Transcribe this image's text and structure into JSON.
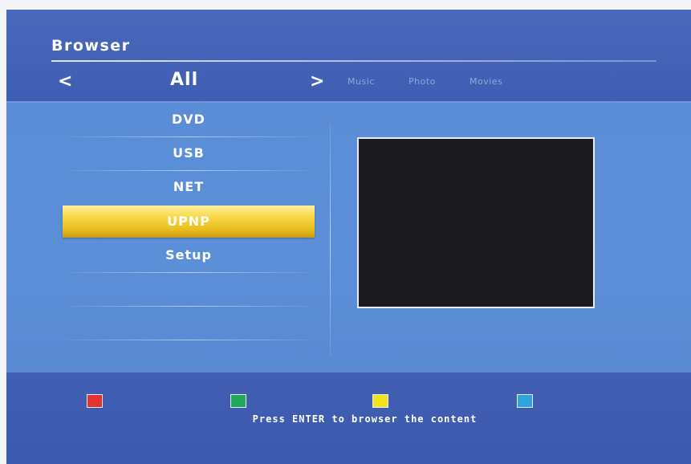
{
  "header": {
    "title": "Browser",
    "nav": {
      "prev_glyph": "<",
      "current_filter": "All",
      "next_glyph": ">",
      "options": [
        "Music",
        "Photo",
        "Movies"
      ]
    }
  },
  "menu": {
    "items": [
      {
        "label": "DVD",
        "selected": false
      },
      {
        "label": "USB",
        "selected": false
      },
      {
        "label": "NET",
        "selected": false
      },
      {
        "label": "UPNP",
        "selected": true
      },
      {
        "label": "Setup",
        "selected": false
      }
    ]
  },
  "footer": {
    "color_buttons": [
      {
        "name": "red",
        "color": "#e2332e"
      },
      {
        "name": "green",
        "color": "#21a85c"
      },
      {
        "name": "yellow",
        "color": "#f3e21b"
      },
      {
        "name": "blue",
        "color": "#2fa2e0"
      }
    ],
    "hint": "Press ENTER to browser the content"
  },
  "colors": {
    "header_bg": "#4a68bb",
    "main_bg": "#5a8dd6",
    "selection": "#f8d84a",
    "preview_bg": "#1b1b1d"
  }
}
